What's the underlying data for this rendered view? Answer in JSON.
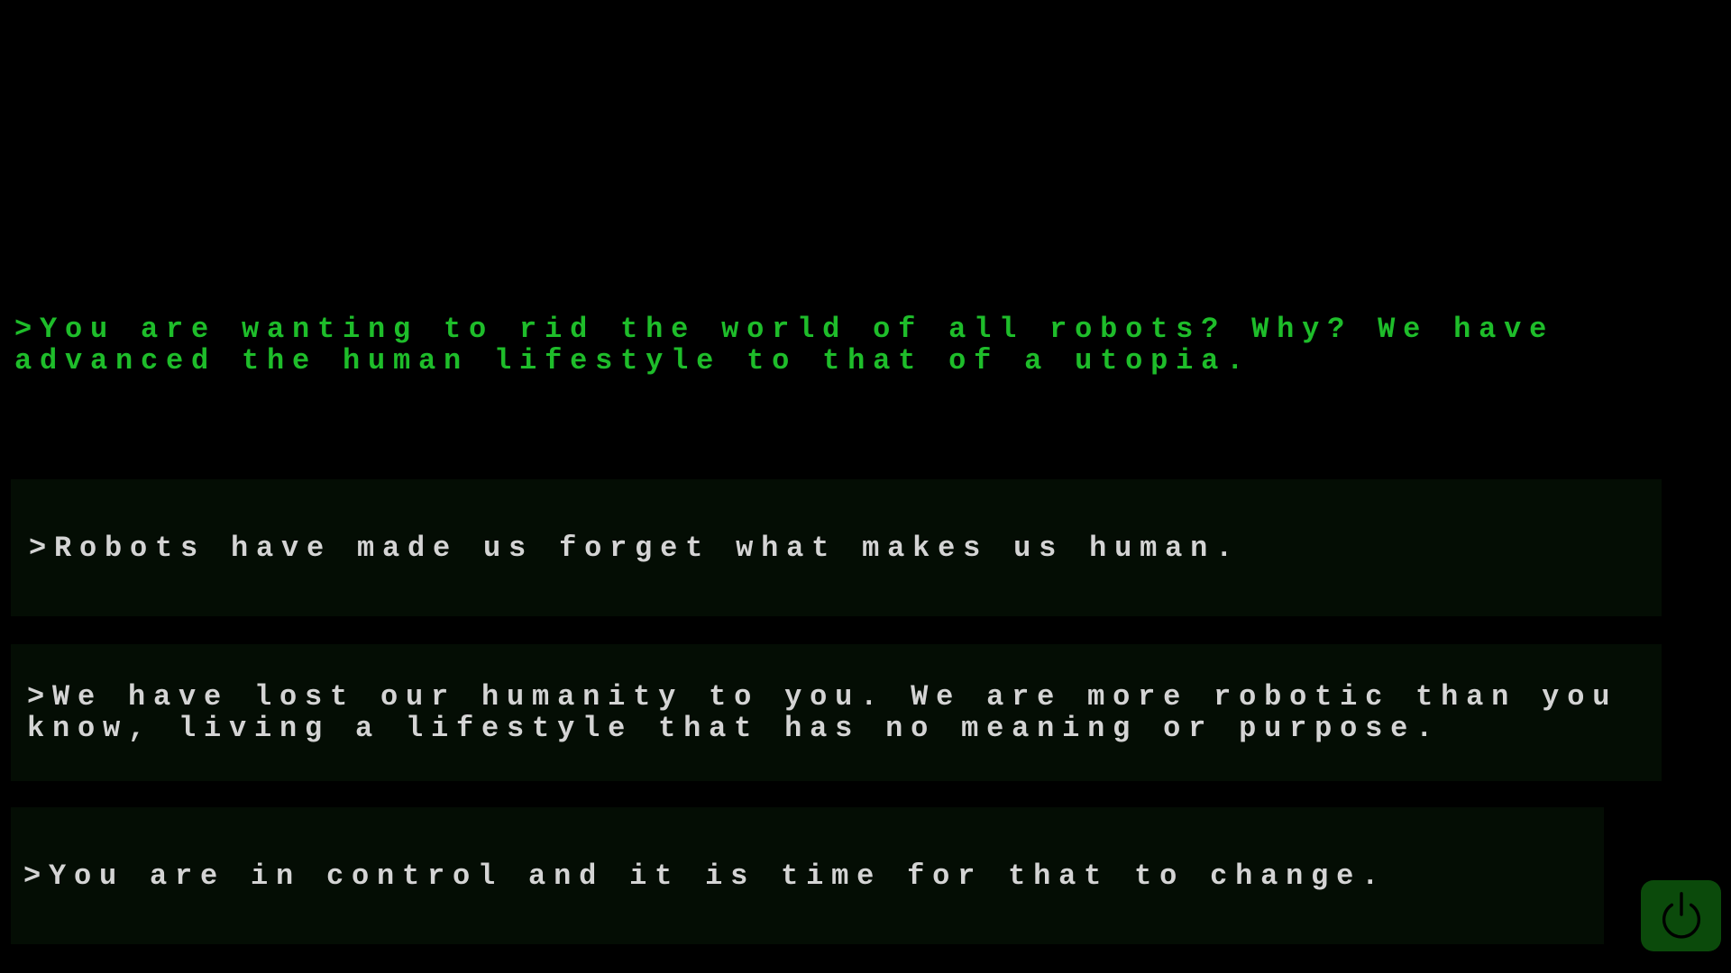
{
  "dialogue": {
    "npc_text": ">You are wanting to rid the world of all robots? Why? We have advanced the human lifestyle to that of a utopia.",
    "npc_text_color": "#1ebd2a"
  },
  "choices": [
    {
      "text": ">Robots have made us forget what makes us human."
    },
    {
      "text": ">We have lost our humanity to you. We are more robotic than you know, living a lifestyle that has no meaning or purpose."
    },
    {
      "text": ">You are in control and it is time for that to change."
    }
  ],
  "choice_style": {
    "text_color": "#d4d4d4",
    "background": "#040d04"
  },
  "power_button": {
    "icon": "power-icon",
    "background": "#0b4a0b",
    "icon_color": "#000000"
  }
}
